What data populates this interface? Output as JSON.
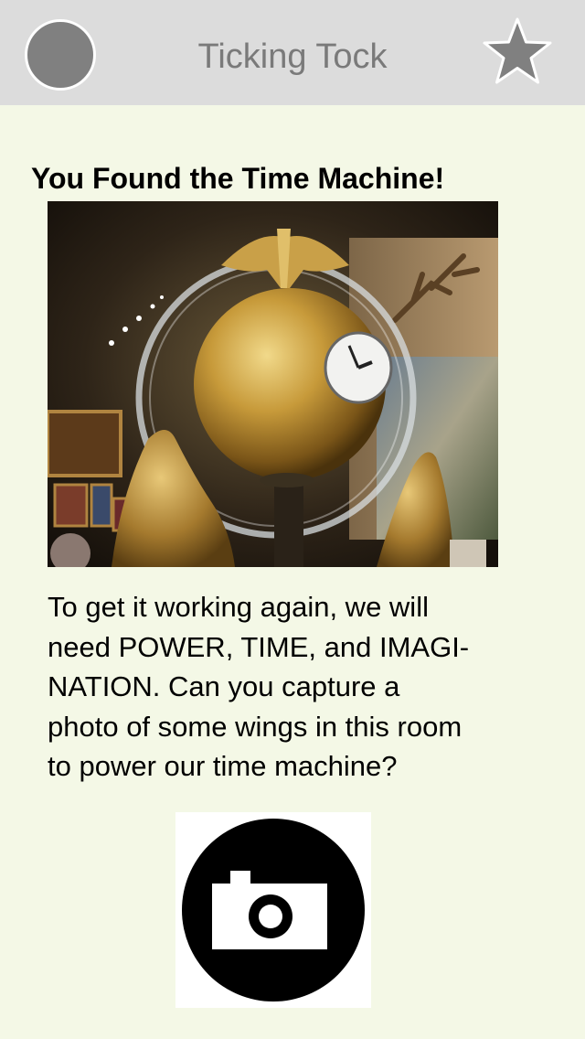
{
  "header": {
    "title": "Ticking Tock",
    "avatar_icon": "avatar-circle",
    "favorite_icon": "star-icon"
  },
  "content": {
    "heading": "You Found the Time Machine!",
    "body_lines": [
      "To get it working again, we will",
      "need POWER, TIME, and IMAGI-",
      "NATION. Can you capture a",
      "photo of some wings in this room",
      "to power our time machine?"
    ],
    "camera_icon": "camera-icon"
  },
  "colors": {
    "background": "#f4f8e6",
    "header": "#dcdcdc",
    "title_text": "#7a7a7a",
    "icon_gray": "#808080"
  }
}
